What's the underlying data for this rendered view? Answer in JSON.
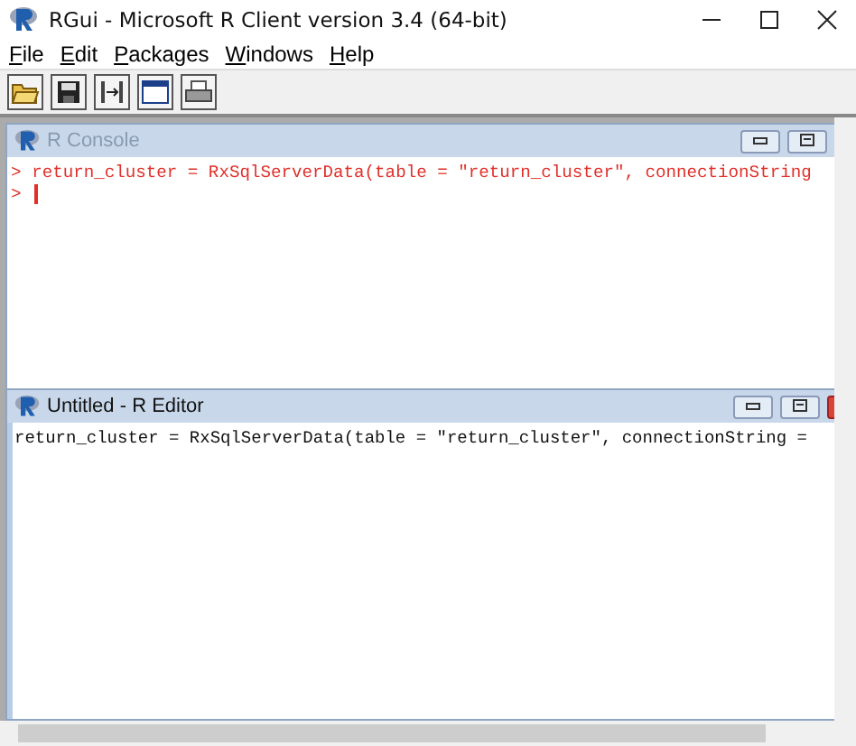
{
  "window": {
    "title": "RGui - Microsoft R Client version 3.4 (64-bit)"
  },
  "menu": [
    {
      "label": "File"
    },
    {
      "label": "Edit"
    },
    {
      "label": "Packages"
    },
    {
      "label": "Windows"
    },
    {
      "label": "Help"
    }
  ],
  "console": {
    "title": "R Console",
    "lines": [
      {
        "prompt": ">",
        "code": "return_cluster = RxSqlServerData(table = \"return_cluster\", connectionString",
        "cursor": false
      },
      {
        "prompt": ">",
        "cursor": true
      }
    ]
  },
  "editor": {
    "title": "Untitled - R Editor",
    "lines": [
      "return_cluster = RxSqlServerData(table = \"return_cluster\", connectionString ="
    ]
  }
}
